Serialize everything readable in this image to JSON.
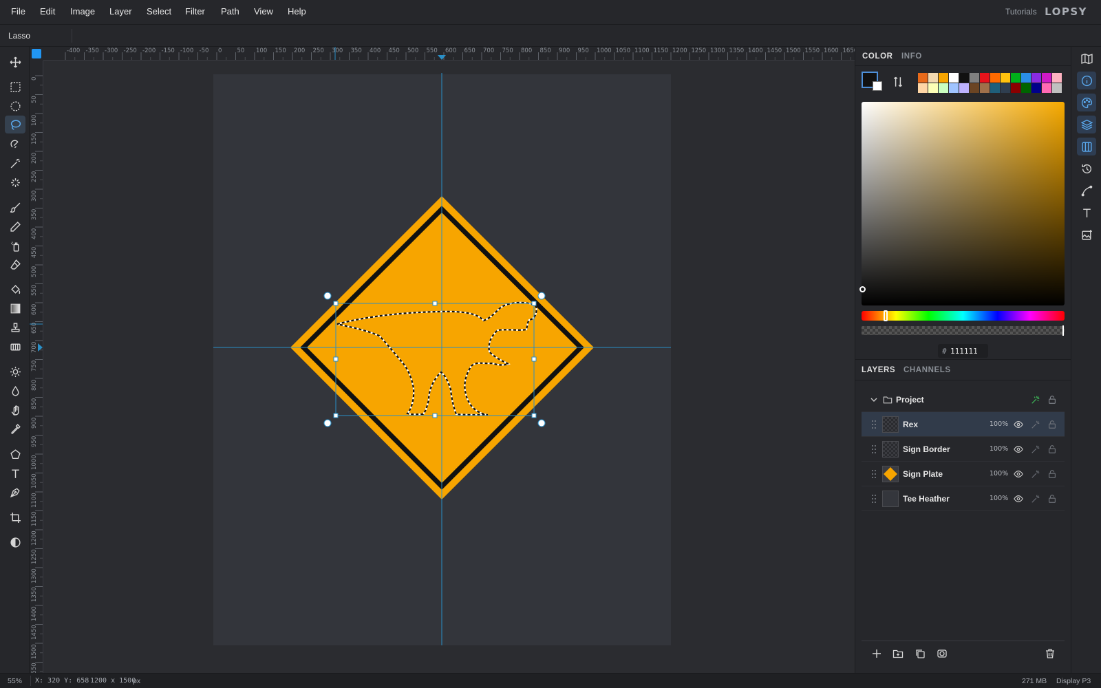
{
  "menubar": {
    "items": [
      "File",
      "Edit",
      "Image",
      "Layer",
      "Select",
      "Filter",
      "Path",
      "View",
      "Help"
    ],
    "tutorials": "Tutorials",
    "brand": "LOPSY"
  },
  "options_bar": {
    "tool_name": "Lasso"
  },
  "toolbar": {
    "active_tool": "lasso",
    "tools": [
      "move",
      "rect-select",
      "ellipse-select",
      "lasso",
      "magnetic-lasso",
      "magic-wand",
      "quick-select",
      "brush",
      "pencil",
      "spray",
      "eraser",
      "fill",
      "gradient",
      "stamp",
      "pattern",
      "dodge",
      "blur",
      "smudge",
      "eyedropper",
      "polygon",
      "text",
      "pen",
      "crop",
      "mask-toggle"
    ]
  },
  "ruler": {
    "top_labels": [
      "-400",
      "-350",
      "-300",
      "-250",
      "-200",
      "-150",
      "-100",
      "-50",
      "0",
      "50",
      "100",
      "150",
      "200",
      "250",
      "300",
      "350",
      "400",
      "450",
      "500",
      "550",
      "600",
      "650",
      "700",
      "750",
      "800",
      "850",
      "900",
      "950",
      "1000",
      "1050",
      "1100",
      "1150",
      "1200",
      "1250",
      "1300",
      "1350",
      "1400",
      "1450",
      "1500",
      "1550",
      "1600",
      "1650"
    ],
    "left_labels": [
      "0",
      "50",
      "100",
      "150",
      "200",
      "250",
      "300",
      "350",
      "400",
      "450",
      "500",
      "550",
      "600",
      "650",
      "700",
      "750",
      "800",
      "850",
      "900",
      "950",
      "1000",
      "1050",
      "1100",
      "1150",
      "1200",
      "1250",
      "1300",
      "1350",
      "1400",
      "1450",
      "1500",
      "1550"
    ]
  },
  "canvas": {
    "sign_color": "#f7a500",
    "border_color": "#111111",
    "background": "#33353b",
    "guide_color": "#2a8fc7"
  },
  "color_panel": {
    "tabs": [
      "COLOR",
      "INFO"
    ],
    "foreground": "#111111",
    "background": "#ffffff",
    "hex_label": "#",
    "hex_value": "111111",
    "palette_row1": [
      "#e86a1a",
      "#f3d9b0",
      "#f7a500",
      "#ffffff",
      "#111111",
      "#808080",
      "#e8131b",
      "#ff6a00",
      "#ffc20e",
      "#00b01a",
      "#2a8fe8",
      "#8a2be2",
      "#d01ac8",
      "#ffb3c1"
    ],
    "palette_row2": [
      "#ffd6a5",
      "#fdffb6",
      "#caffbf",
      "#a0c4ff",
      "#bdb2ff",
      "#6b4423",
      "#a0704a",
      "#1f5f7a",
      "#2f3e4f",
      "#8b0000",
      "#006400",
      "#00008b",
      "#ff69b4",
      "#c0c0c0"
    ]
  },
  "layers_panel": {
    "tabs": [
      "LAYERS",
      "CHANNELS"
    ],
    "group": {
      "name": "Project"
    },
    "layers": [
      {
        "name": "Rex",
        "opacity": "100%",
        "selected": true,
        "thumb": "transparent"
      },
      {
        "name": "Sign Border",
        "opacity": "100%",
        "selected": false,
        "thumb": "transparent"
      },
      {
        "name": "Sign Plate",
        "opacity": "100%",
        "selected": false,
        "thumb": "diamond"
      },
      {
        "name": "Tee Heather",
        "opacity": "100%",
        "selected": false,
        "thumb": "dark"
      }
    ],
    "footer_actions": [
      "add-layer",
      "new-group",
      "duplicate-layer",
      "mask",
      "delete-layer"
    ]
  },
  "right_sidebar": [
    "navigator",
    "info",
    "color",
    "layers",
    "channels",
    "history",
    "paths",
    "character",
    "image-adjust"
  ],
  "status": {
    "zoom": "55%",
    "coords_label": "X: 320  Y: 658",
    "size": "1200 x 1500",
    "size_unit": "px",
    "memory": "271 MB",
    "color_profile": "Display P3"
  }
}
